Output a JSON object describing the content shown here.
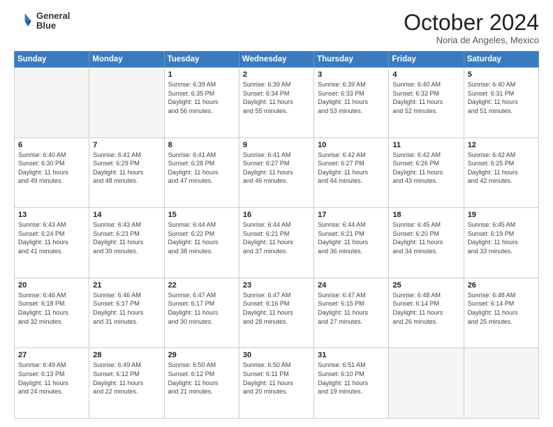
{
  "header": {
    "logo_line1": "General",
    "logo_line2": "Blue",
    "month": "October 2024",
    "location": "Noria de Angeles, Mexico"
  },
  "days_of_week": [
    "Sunday",
    "Monday",
    "Tuesday",
    "Wednesday",
    "Thursday",
    "Friday",
    "Saturday"
  ],
  "weeks": [
    [
      {
        "day": "",
        "detail": ""
      },
      {
        "day": "",
        "detail": ""
      },
      {
        "day": "1",
        "detail": "Sunrise: 6:39 AM\nSunset: 6:35 PM\nDaylight: 11 hours\nand 56 minutes."
      },
      {
        "day": "2",
        "detail": "Sunrise: 6:39 AM\nSunset: 6:34 PM\nDaylight: 11 hours\nand 55 minutes."
      },
      {
        "day": "3",
        "detail": "Sunrise: 6:39 AM\nSunset: 6:33 PM\nDaylight: 11 hours\nand 53 minutes."
      },
      {
        "day": "4",
        "detail": "Sunrise: 6:40 AM\nSunset: 6:32 PM\nDaylight: 11 hours\nand 52 minutes."
      },
      {
        "day": "5",
        "detail": "Sunrise: 6:40 AM\nSunset: 6:31 PM\nDaylight: 11 hours\nand 51 minutes."
      }
    ],
    [
      {
        "day": "6",
        "detail": "Sunrise: 6:40 AM\nSunset: 6:30 PM\nDaylight: 11 hours\nand 49 minutes."
      },
      {
        "day": "7",
        "detail": "Sunrise: 6:41 AM\nSunset: 6:29 PM\nDaylight: 11 hours\nand 48 minutes."
      },
      {
        "day": "8",
        "detail": "Sunrise: 6:41 AM\nSunset: 6:28 PM\nDaylight: 11 hours\nand 47 minutes."
      },
      {
        "day": "9",
        "detail": "Sunrise: 6:41 AM\nSunset: 6:27 PM\nDaylight: 11 hours\nand 46 minutes."
      },
      {
        "day": "10",
        "detail": "Sunrise: 6:42 AM\nSunset: 6:27 PM\nDaylight: 11 hours\nand 44 minutes."
      },
      {
        "day": "11",
        "detail": "Sunrise: 6:42 AM\nSunset: 6:26 PM\nDaylight: 11 hours\nand 43 minutes."
      },
      {
        "day": "12",
        "detail": "Sunrise: 6:42 AM\nSunset: 6:25 PM\nDaylight: 11 hours\nand 42 minutes."
      }
    ],
    [
      {
        "day": "13",
        "detail": "Sunrise: 6:43 AM\nSunset: 6:24 PM\nDaylight: 11 hours\nand 41 minutes."
      },
      {
        "day": "14",
        "detail": "Sunrise: 6:43 AM\nSunset: 6:23 PM\nDaylight: 11 hours\nand 39 minutes."
      },
      {
        "day": "15",
        "detail": "Sunrise: 6:44 AM\nSunset: 6:22 PM\nDaylight: 11 hours\nand 38 minutes."
      },
      {
        "day": "16",
        "detail": "Sunrise: 6:44 AM\nSunset: 6:21 PM\nDaylight: 11 hours\nand 37 minutes."
      },
      {
        "day": "17",
        "detail": "Sunrise: 6:44 AM\nSunset: 6:21 PM\nDaylight: 11 hours\nand 36 minutes."
      },
      {
        "day": "18",
        "detail": "Sunrise: 6:45 AM\nSunset: 6:20 PM\nDaylight: 11 hours\nand 34 minutes."
      },
      {
        "day": "19",
        "detail": "Sunrise: 6:45 AM\nSunset: 6:19 PM\nDaylight: 11 hours\nand 33 minutes."
      }
    ],
    [
      {
        "day": "20",
        "detail": "Sunrise: 6:46 AM\nSunset: 6:18 PM\nDaylight: 11 hours\nand 32 minutes."
      },
      {
        "day": "21",
        "detail": "Sunrise: 6:46 AM\nSunset: 6:17 PM\nDaylight: 11 hours\nand 31 minutes."
      },
      {
        "day": "22",
        "detail": "Sunrise: 6:47 AM\nSunset: 6:17 PM\nDaylight: 11 hours\nand 30 minutes."
      },
      {
        "day": "23",
        "detail": "Sunrise: 6:47 AM\nSunset: 6:16 PM\nDaylight: 11 hours\nand 28 minutes."
      },
      {
        "day": "24",
        "detail": "Sunrise: 6:47 AM\nSunset: 6:15 PM\nDaylight: 11 hours\nand 27 minutes."
      },
      {
        "day": "25",
        "detail": "Sunrise: 6:48 AM\nSunset: 6:14 PM\nDaylight: 11 hours\nand 26 minutes."
      },
      {
        "day": "26",
        "detail": "Sunrise: 6:48 AM\nSunset: 6:14 PM\nDaylight: 11 hours\nand 25 minutes."
      }
    ],
    [
      {
        "day": "27",
        "detail": "Sunrise: 6:49 AM\nSunset: 6:13 PM\nDaylight: 11 hours\nand 24 minutes."
      },
      {
        "day": "28",
        "detail": "Sunrise: 6:49 AM\nSunset: 6:12 PM\nDaylight: 11 hours\nand 22 minutes."
      },
      {
        "day": "29",
        "detail": "Sunrise: 6:50 AM\nSunset: 6:12 PM\nDaylight: 11 hours\nand 21 minutes."
      },
      {
        "day": "30",
        "detail": "Sunrise: 6:50 AM\nSunset: 6:11 PM\nDaylight: 11 hours\nand 20 minutes."
      },
      {
        "day": "31",
        "detail": "Sunrise: 6:51 AM\nSunset: 6:10 PM\nDaylight: 11 hours\nand 19 minutes."
      },
      {
        "day": "",
        "detail": ""
      },
      {
        "day": "",
        "detail": ""
      }
    ]
  ]
}
